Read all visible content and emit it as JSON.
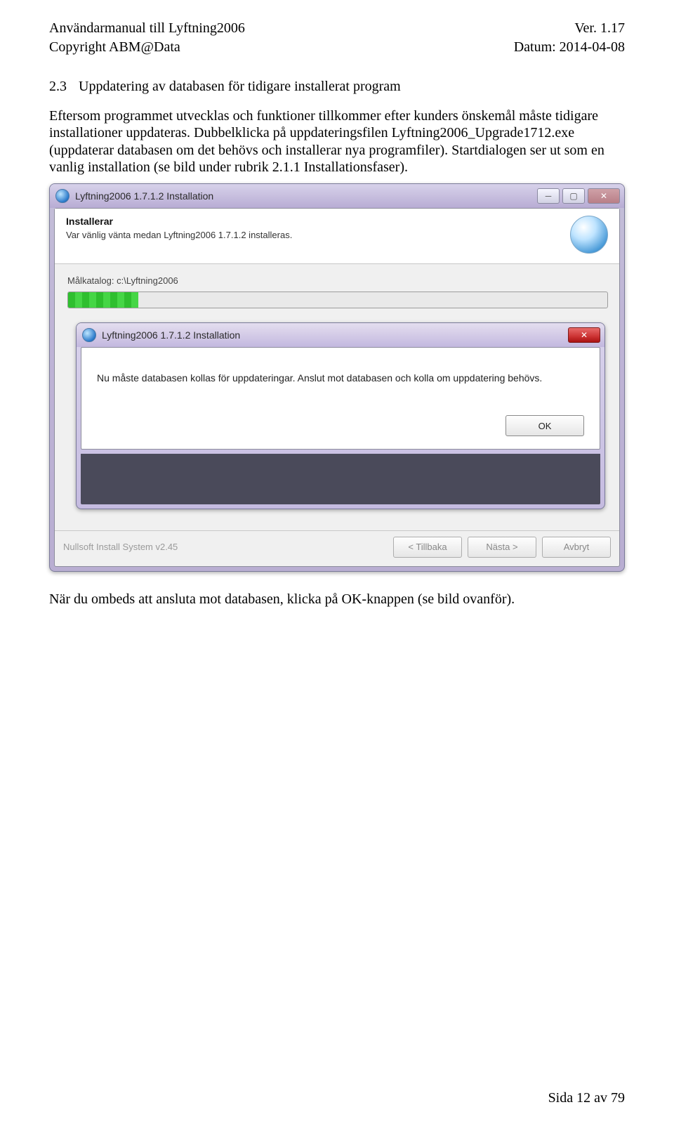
{
  "header": {
    "left1": "Användarmanual till Lyftning2006",
    "left2": "Copyright ABM@Data",
    "right1": "Ver. 1.17",
    "right2": "Datum: 2014-04-08"
  },
  "section": {
    "number": "2.3",
    "title": "Uppdatering av databasen för tidigare installerat program"
  },
  "paragraph1": "Eftersom programmet utvecklas och funktioner tillkommer efter kunders önskemål måste tidigare installationer uppdateras. Dubbelklicka på uppdateringsfilen Lyftning2006_Upgrade1712.exe (uppdaterar databasen om det behövs och installerar nya programfiler). Startdialogen ser ut som en vanlig installation (se bild under rubrik 2.1.1 Installationsfaser).",
  "installer": {
    "title": "Lyftning2006 1.7.1.2 Installation",
    "header": "Installerar",
    "sub": "Var vänlig vänta medan Lyftning2006 1.7.1.2 installeras.",
    "targetLabel": "Målkatalog: c:\\Lyftning2006",
    "nsis": "Nullsoft Install System v2.45",
    "btnBack": "< Tillbaka",
    "btnNext": "Nästa >",
    "btnCancel": "Avbryt"
  },
  "modal": {
    "title": "Lyftning2006 1.7.1.2 Installation",
    "message": "Nu måste databasen kollas för uppdateringar. Anslut mot databasen och kolla om uppdatering behövs.",
    "ok": "OK"
  },
  "paragraph2": "När du ombeds att ansluta mot databasen, klicka på OK-knappen (se bild ovanför).",
  "footer": "Sida 12 av 79"
}
